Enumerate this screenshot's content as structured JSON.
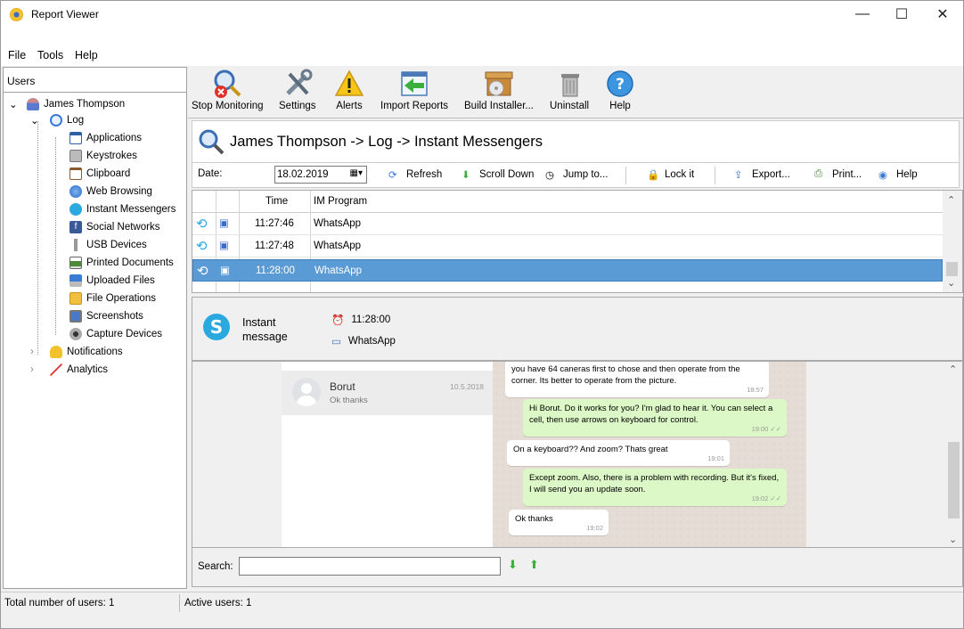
{
  "window": {
    "title": "Report Viewer",
    "minimize": "—",
    "maximize": "☐",
    "close": "✕"
  },
  "menu": [
    "File",
    "Tools",
    "Help"
  ],
  "users_panel": {
    "header": "Users",
    "user": "James Thompson",
    "log": "Log",
    "log_items": [
      "Applications",
      "Keystrokes",
      "Clipboard",
      "Web Browsing",
      "Instant Messengers",
      "Social Networks",
      "USB Devices",
      "Printed Documents",
      "Uploaded Files",
      "File Operations",
      "Screenshots",
      "Capture Devices"
    ],
    "notifications": "Notifications",
    "analytics": "Analytics"
  },
  "toolbar": {
    "stop_monitoring": "Stop Monitoring",
    "settings": "Settings",
    "alerts": "Alerts",
    "import_reports": "Import Reports",
    "build_installer": "Build Installer...",
    "uninstall": "Uninstall",
    "help": "Help"
  },
  "heading": "James Thompson -> Log -> Instant Messengers",
  "filters": {
    "date_label": "Date:",
    "date_value": "18.02.2019",
    "refresh": "Refresh",
    "scroll_down": "Scroll Down",
    "jump_to": "Jump to...",
    "lock": "Lock it",
    "export": "Export...",
    "print": "Print...",
    "help": "Help"
  },
  "grid": {
    "columns": [
      "Time",
      "IM Program"
    ],
    "rows": [
      {
        "time": "11:27:46",
        "program": "WhatsApp"
      },
      {
        "time": "11:27:48",
        "program": "WhatsApp"
      },
      {
        "time": "11:28:00",
        "program": "WhatsApp"
      }
    ]
  },
  "detail": {
    "title_line1": "Instant",
    "title_line2": "message",
    "time": "11:28:00",
    "program": "WhatsApp"
  },
  "chat": {
    "contact_name": "Borut",
    "contact_date": "10.5.2018",
    "contact_preview": "Ok thanks",
    "messages": [
      {
        "dir": "in",
        "text": "you have 64 caneras first to chose and then operate from the corner. Its better to operate from the picture.",
        "time": "18:57"
      },
      {
        "dir": "out",
        "text": "Hi Borut. Do it works for you? I'm glad to hear it. You can select a cell, then use arrows on keyboard for control.",
        "time": "19:00 ✓✓"
      },
      {
        "dir": "in",
        "text": "On a keyboard?? And zoom? Thats great",
        "time": "19:01"
      },
      {
        "dir": "out",
        "text": "Except zoom. Also, there is a problem with recording. But it's fixed, I will send you an update soon.",
        "time": "19:02 ✓✓"
      },
      {
        "dir": "in",
        "text": "Ok thanks",
        "time": "19:02"
      }
    ]
  },
  "search": {
    "label": "Search:",
    "value": ""
  },
  "status": {
    "total": "Total number of users: 1",
    "active": "Active users: 1"
  },
  "colors": {
    "selection": "#5b9bd5",
    "chat_out": "#dcf8c6",
    "chat_bg": "#e5ddd5"
  }
}
